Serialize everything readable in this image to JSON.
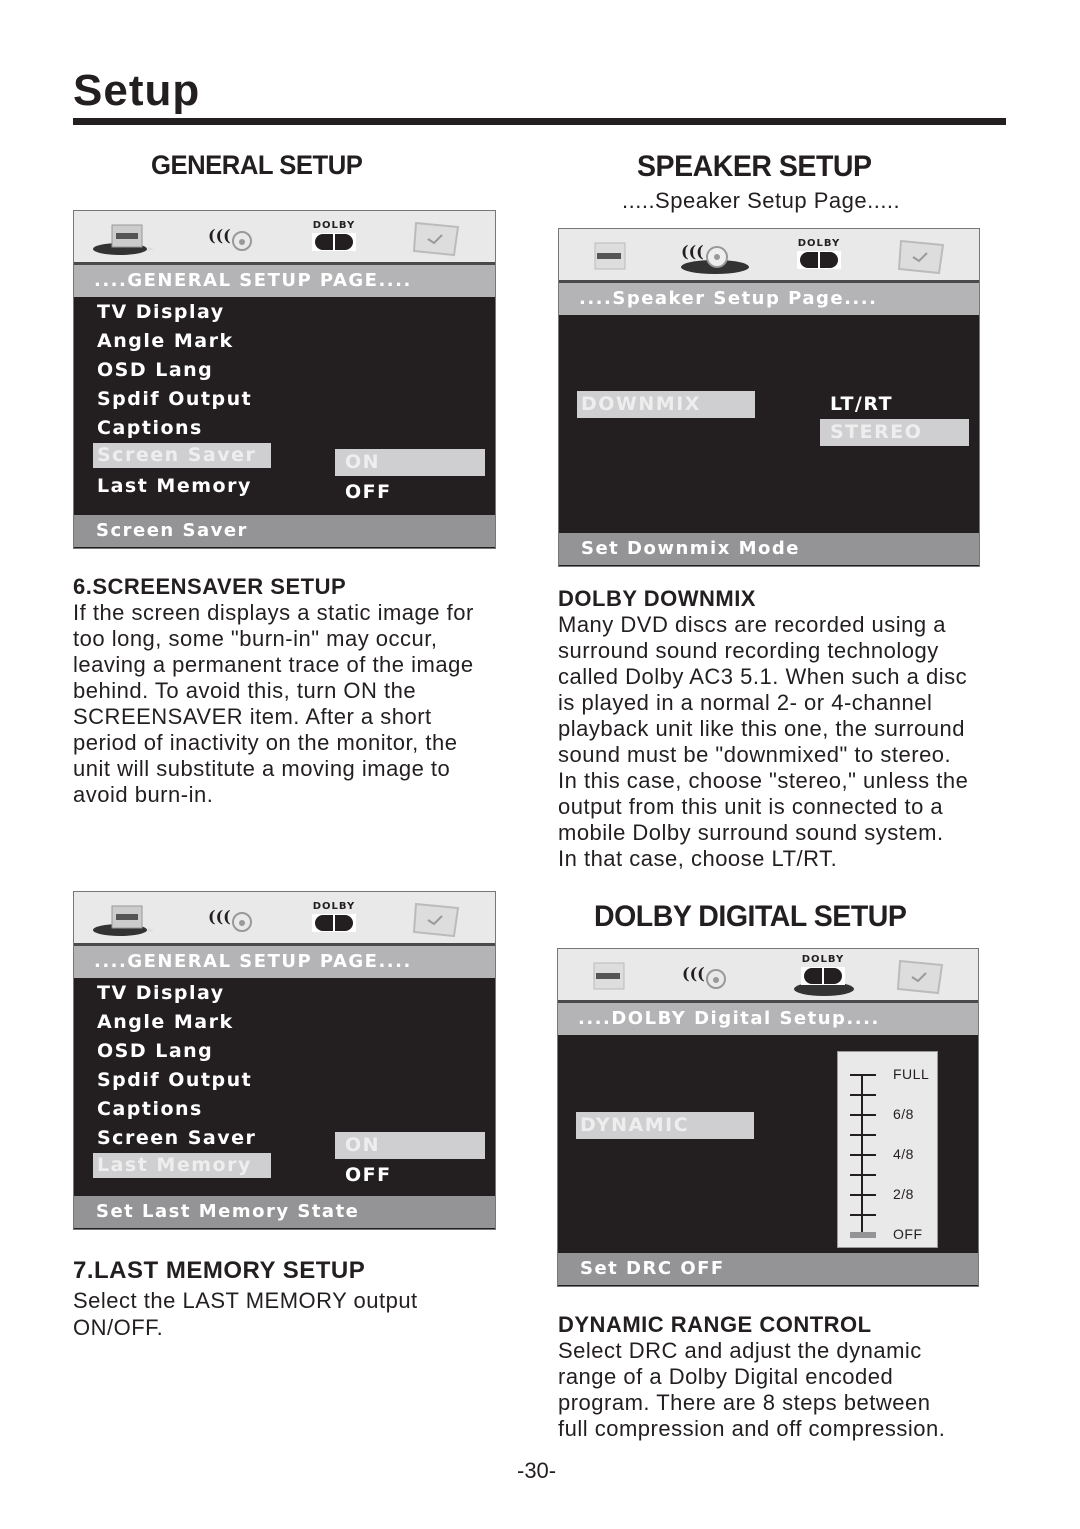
{
  "page": {
    "title": "Setup",
    "page_number": "-30-"
  },
  "general_setup": {
    "heading": "GENERAL SETUP",
    "screen1": {
      "page_label": "....GENERAL SETUP PAGE....",
      "items": [
        "TV Display",
        "Angle Mark",
        "OSD Lang",
        "Spdif Output",
        "Captions",
        "Screen Saver",
        "Last Memory"
      ],
      "selected_item": "Screen Saver",
      "options": [
        "ON",
        "OFF"
      ],
      "selected_option": "ON",
      "status": "Screen Saver"
    },
    "screen2": {
      "page_label": "....GENERAL SETUP PAGE....",
      "items": [
        "TV Display",
        "Angle Mark",
        "OSD Lang",
        "Spdif Output",
        "Captions",
        "Screen Saver",
        "Last Memory"
      ],
      "selected_item": "Last Memory",
      "options": [
        "ON",
        "OFF"
      ],
      "selected_option": "ON",
      "status": "Set Last Memory State"
    },
    "screensaver_section": {
      "heading": "6.SCREENSAVER SETUP",
      "text": "If the screen displays a static image for\ntoo long, some \"burn-in\" may occur,\nleaving a permanent trace of the image\nbehind. To avoid this, turn ON the\nSCREENSAVER item. After a short\nperiod of inactivity on the monitor, the\nunit will substitute a moving image to\navoid burn-in."
    },
    "last_memory_section": {
      "heading": "7.LAST MEMORY SETUP",
      "text": "Select the LAST MEMORY output\nON/OFF."
    }
  },
  "speaker_setup": {
    "heading": "SPEAKER SETUP",
    "caption": ".....Speaker Setup Page.....",
    "screen": {
      "page_label": "....Speaker Setup Page....",
      "item": "DOWNMIX",
      "options": [
        "LT/RT",
        "STEREO"
      ],
      "selected_option": "STEREO",
      "status": "Set Downmix Mode"
    },
    "downmix_section": {
      "heading": "DOLBY DOWNMIX",
      "text": "Many DVD discs are recorded using a\nsurround sound recording technology\ncalled Dolby AC3 5.1. When such a disc\nis played in a normal 2- or 4-channel\nplayback unit like this one, the surround\nsound must be \"downmixed\" to stereo.\nIn this case, choose \"stereo,\" unless the\noutput from this unit is connected to a\nmobile Dolby surround sound system.\nIn that case, choose LT/RT."
    }
  },
  "dolby_digital_setup": {
    "heading": "DOLBY DIGITAL SETUP",
    "screen": {
      "page_label": "....DOLBY Digital Setup....",
      "item": "DYNAMIC",
      "slider_labels": [
        "FULL",
        "6/8",
        "4/8",
        "2/8",
        "OFF"
      ],
      "slider_steps": 8,
      "slider_value": "OFF",
      "slider_level_fraction": 0,
      "status": "Set DRC OFF"
    },
    "drc_section": {
      "heading": "DYNAMIC RANGE CONTROL",
      "text": "Select DRC and adjust the dynamic\nrange of a Dolby Digital encoded\nprogram.  There are 8 steps between\nfull compression and off compression."
    }
  },
  "icons": {
    "tabs": [
      "general-setup-tv-icon",
      "speaker-setup-icon",
      "dolby-digital-icon",
      "preference-icon"
    ],
    "dolby_word": "DOLBY"
  }
}
